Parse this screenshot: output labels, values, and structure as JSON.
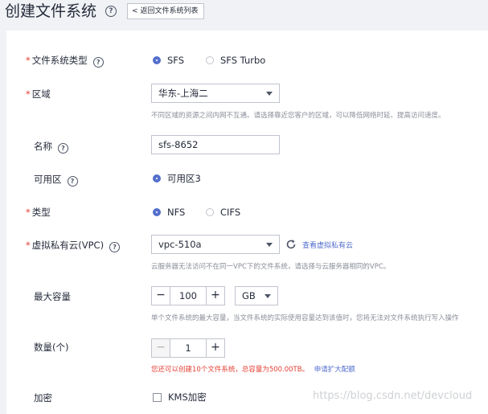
{
  "header": {
    "title": "创建文件系统",
    "back_label": "返回文件系统列表"
  },
  "form": {
    "fs_type": {
      "label": "文件系统类型",
      "options": [
        "SFS",
        "SFS Turbo"
      ],
      "selected": "SFS"
    },
    "region": {
      "label": "区域",
      "value": "华东-上海二",
      "hint": "不同区域的资源之间内网不互通。请选择靠近您客户的区域，可以降低网络时延、提高访问速度。"
    },
    "name": {
      "label": "名称",
      "value": "sfs-8652"
    },
    "az": {
      "label": "可用区",
      "option": "可用区3"
    },
    "protocol": {
      "label": "类型",
      "options": [
        "NFS",
        "CIFS"
      ],
      "selected": "NFS"
    },
    "vpc": {
      "label": "虚拟私有云(VPC)",
      "value": "vpc-510a",
      "link": "查看虚拟私有云",
      "hint": "云服务器无法访问不在同一VPC下的文件系统，请选择与云服务器相同的VPC。"
    },
    "capacity": {
      "label": "最大容量",
      "value": "100",
      "minus": "−",
      "plus": "+",
      "unit": "GB",
      "hint": "单个文件系统的最大容量，当文件系统的实际使用容量达到该值时，您将无法对文件系统执行写入操作"
    },
    "quantity": {
      "label": "数量(个)",
      "value": "1",
      "minus": "−",
      "plus": "+",
      "notice": "您还可以创建10个文件系统，总容量为500.00TB。",
      "notice_link": "申请扩大配额"
    },
    "encryption": {
      "label": "加密",
      "option": "KMS加密"
    }
  },
  "watermark": "https://blog.csdn.net/devcloud",
  "colors": {
    "accent": "#526ecc",
    "required": "#e33e33",
    "hint": "#8a8e99"
  }
}
